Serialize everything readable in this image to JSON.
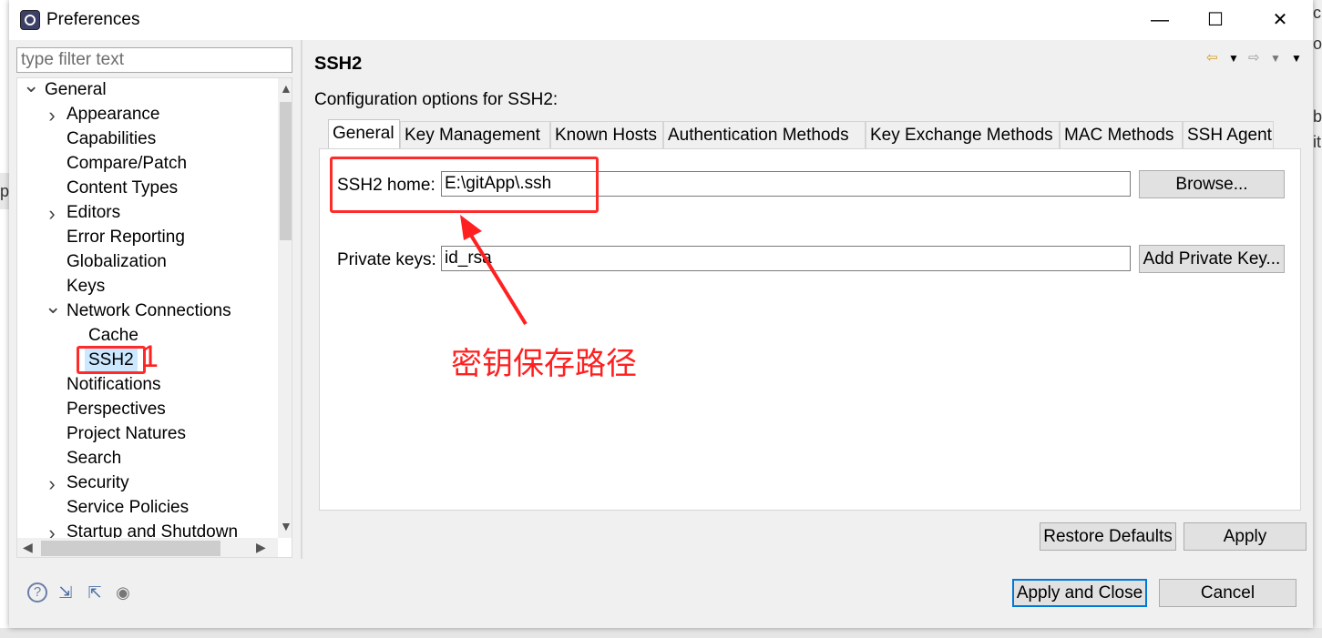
{
  "window": {
    "title": "Preferences",
    "minimize_glyph": "—",
    "maximize_glyph": "☐",
    "close_glyph": "✕"
  },
  "filter": {
    "placeholder": "type filter text"
  },
  "tree": {
    "selected": "SSH2",
    "items": [
      {
        "label": "General",
        "depth": 0,
        "arrow": "expanded"
      },
      {
        "label": "Appearance",
        "depth": 1,
        "arrow": "collapsed"
      },
      {
        "label": "Capabilities",
        "depth": 1,
        "arrow": "none"
      },
      {
        "label": "Compare/Patch",
        "depth": 1,
        "arrow": "none"
      },
      {
        "label": "Content Types",
        "depth": 1,
        "arrow": "none"
      },
      {
        "label": "Editors",
        "depth": 1,
        "arrow": "collapsed"
      },
      {
        "label": "Error Reporting",
        "depth": 1,
        "arrow": "none"
      },
      {
        "label": "Globalization",
        "depth": 1,
        "arrow": "none"
      },
      {
        "label": "Keys",
        "depth": 1,
        "arrow": "none"
      },
      {
        "label": "Network Connections",
        "depth": 1,
        "arrow": "expanded"
      },
      {
        "label": "Cache",
        "depth": 2,
        "arrow": "none"
      },
      {
        "label": "SSH2",
        "depth": 2,
        "arrow": "none"
      },
      {
        "label": "Notifications",
        "depth": 1,
        "arrow": "none"
      },
      {
        "label": "Perspectives",
        "depth": 1,
        "arrow": "none"
      },
      {
        "label": "Project Natures",
        "depth": 1,
        "arrow": "none"
      },
      {
        "label": "Search",
        "depth": 1,
        "arrow": "none"
      },
      {
        "label": "Security",
        "depth": 1,
        "arrow": "collapsed"
      },
      {
        "label": "Service Policies",
        "depth": 1,
        "arrow": "none"
      },
      {
        "label": "Startup and Shutdown",
        "depth": 1,
        "arrow": "collapsed"
      }
    ]
  },
  "page": {
    "title": "SSH2",
    "subtitle": "Configuration options for SSH2:",
    "tabs": [
      {
        "label": "General",
        "active": true
      },
      {
        "label": "Key Management",
        "active": false
      },
      {
        "label": "Known Hosts",
        "active": false
      },
      {
        "label": "Authentication Methods",
        "active": false
      },
      {
        "label": "Key Exchange Methods",
        "active": false
      },
      {
        "label": "MAC Methods",
        "active": false
      },
      {
        "label": "SSH Agent",
        "active": false
      }
    ],
    "ssh2_home": {
      "label": "SSH2 home:",
      "value": "E:\\gitApp\\.ssh",
      "button": "Browse..."
    },
    "private_keys": {
      "label": "Private keys:",
      "value": "id_rsa",
      "button": "Add Private Key..."
    }
  },
  "buttons": {
    "restore_defaults": "Restore Defaults",
    "apply": "Apply",
    "apply_and_close": "Apply and Close",
    "cancel": "Cancel"
  },
  "annotations": {
    "step_number": "1",
    "note": "密钥保存路径",
    "color": "#ff2a2a"
  },
  "icons": {
    "help": "question-circle-icon",
    "import": "import-icon",
    "export": "export-icon",
    "record": "record-icon"
  }
}
